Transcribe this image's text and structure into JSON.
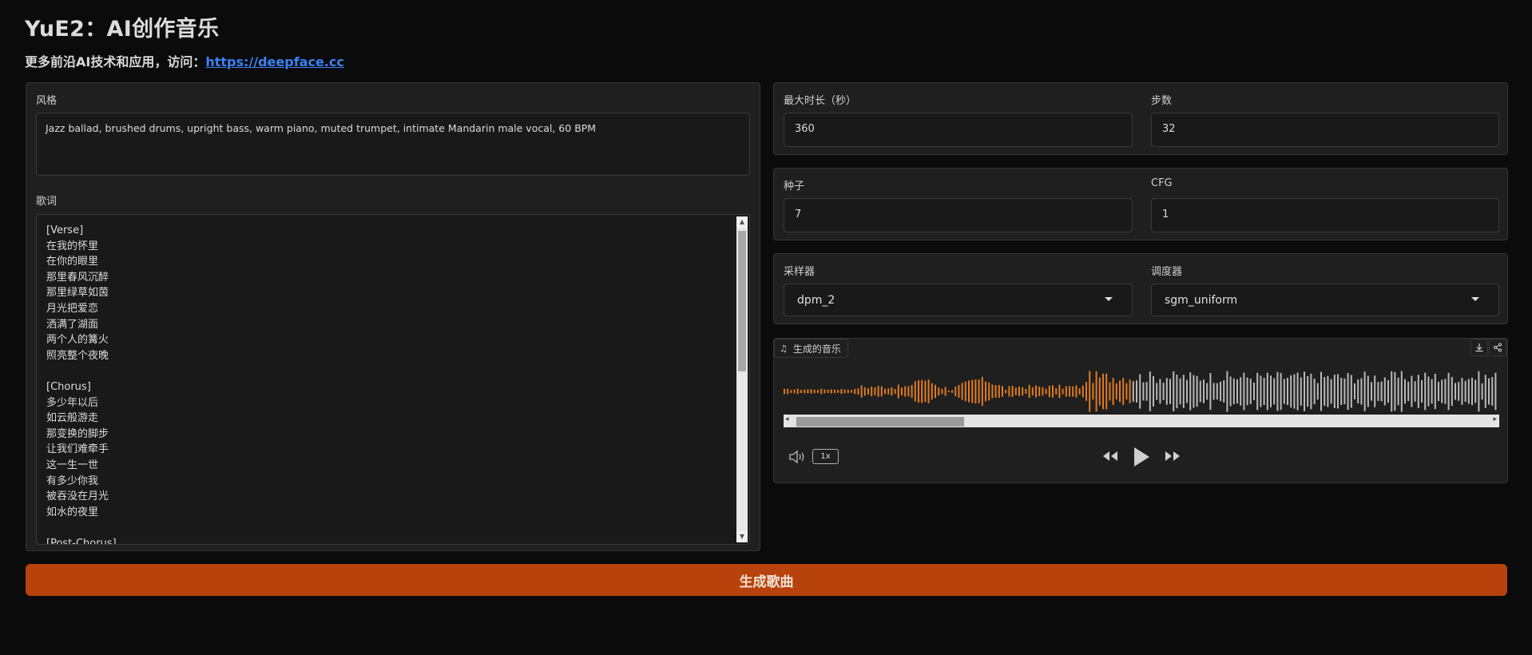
{
  "header": {
    "title": "YuE2：AI创作音乐",
    "subtitle_text": "更多前沿AI技术和应用，访问：",
    "link_text": "https://deepface.cc"
  },
  "style_field": {
    "label": "风格",
    "value": "Jazz ballad, brushed drums, upright bass, warm piano, muted trumpet, intimate Mandarin male vocal, 60 BPM"
  },
  "lyrics_field": {
    "label": "歌词",
    "lines": [
      "[Verse]",
      "在我的怀里",
      "在你的眼里",
      "那里春风沉醉",
      "那里绿草如茵",
      "月光把爱恋",
      "洒满了湖面",
      "两个人的篝火",
      "照亮整个夜晚",
      "",
      "[Chorus]",
      "多少年以后",
      "如云般游走",
      "那变换的脚步",
      "让我们难牵手",
      "这一生一世",
      "有多少你我",
      "被吞没在月光",
      "如水的夜里",
      "",
      "[Post-Chorus]"
    ]
  },
  "params": {
    "max_duration": {
      "label": "最大时长（秒）",
      "value": "360"
    },
    "steps": {
      "label": "步数",
      "value": "32"
    },
    "seed": {
      "label": "种子",
      "value": "7"
    },
    "cfg": {
      "label": "CFG",
      "value": "1"
    },
    "sampler": {
      "label": "采样器",
      "value": "dpm_2"
    },
    "scheduler": {
      "label": "调度器",
      "value": "sgm_uniform"
    }
  },
  "audio": {
    "label": "生成的音乐",
    "speed": "1x",
    "progress": 0.49,
    "played_color": "#e07b20",
    "unplayed_color": "#b9b9b9"
  },
  "generate_button": {
    "label": "生成歌曲"
  },
  "colors": {
    "accent": "#b8420b",
    "link": "#3b82f6",
    "panel": "#1f1f1f",
    "background": "#0b0b0b"
  }
}
